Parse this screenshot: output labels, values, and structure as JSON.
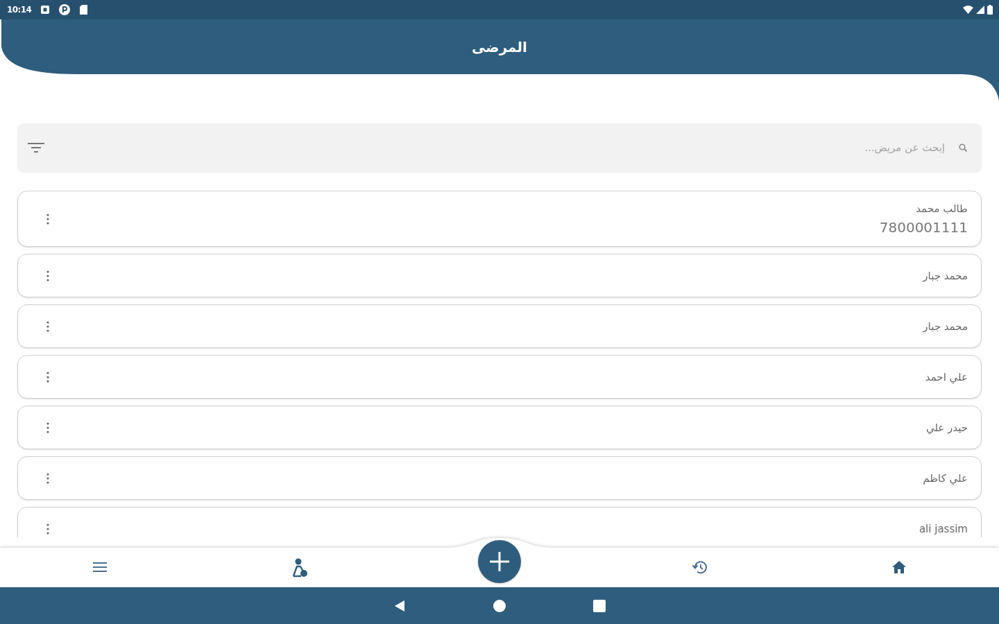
{
  "status_bar": {
    "time": "10:14"
  },
  "header": {
    "title": "المرضى"
  },
  "search": {
    "placeholder": "إبحث عن مريض..."
  },
  "patients": [
    {
      "name": "طالب محمد",
      "phone": "7800001111"
    },
    {
      "name": "محمد جبار"
    },
    {
      "name": "محمد جبار"
    },
    {
      "name": "علي احمد"
    },
    {
      "name": "حيدر علي"
    },
    {
      "name": "علي كاظم"
    },
    {
      "name": "ali jassim"
    }
  ]
}
